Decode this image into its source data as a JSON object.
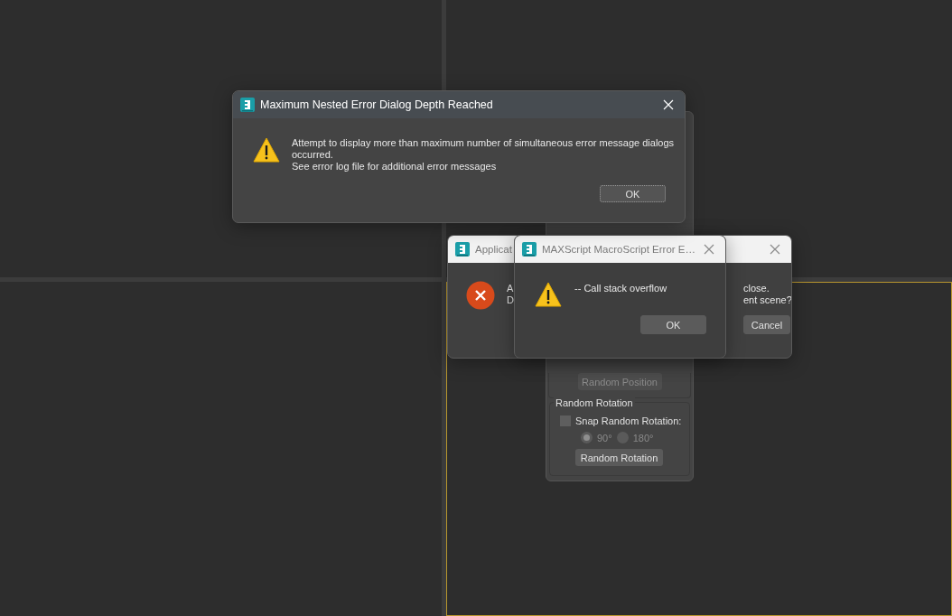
{
  "viewports": [
    {
      "active": false
    },
    {
      "active": false
    },
    {
      "active": false
    },
    {
      "active": true
    }
  ],
  "rollout": {
    "random_position_button": "Random Position",
    "group_title": "Random Rotation",
    "snap": {
      "label": "Snap Random Rotation:",
      "checked": false
    },
    "angles": [
      {
        "label": "90°",
        "selected": true
      },
      {
        "label": "180°",
        "selected": false
      }
    ],
    "random_rotation_button": "Random Rotation"
  },
  "application_dialog": {
    "title": "Applicat",
    "kind": "error",
    "text_left": [
      "A",
      "D"
    ],
    "text_right": [
      "close.",
      "ent scene?"
    ],
    "button": "Cancel"
  },
  "macroscript_dialog": {
    "title": "MAXScript MacroScript Error E…",
    "kind": "warning",
    "message": "-- Call stack overflow",
    "button": "OK"
  },
  "depth_dialog": {
    "title": "Maximum Nested Error Dialog Depth Reached",
    "kind": "warning",
    "message_lines": [
      "Attempt to display more than maximum number of simultaneous error message dialogs occurred.",
      "See error log file for additional error messages"
    ],
    "button": "OK",
    "button_focused": true
  }
}
